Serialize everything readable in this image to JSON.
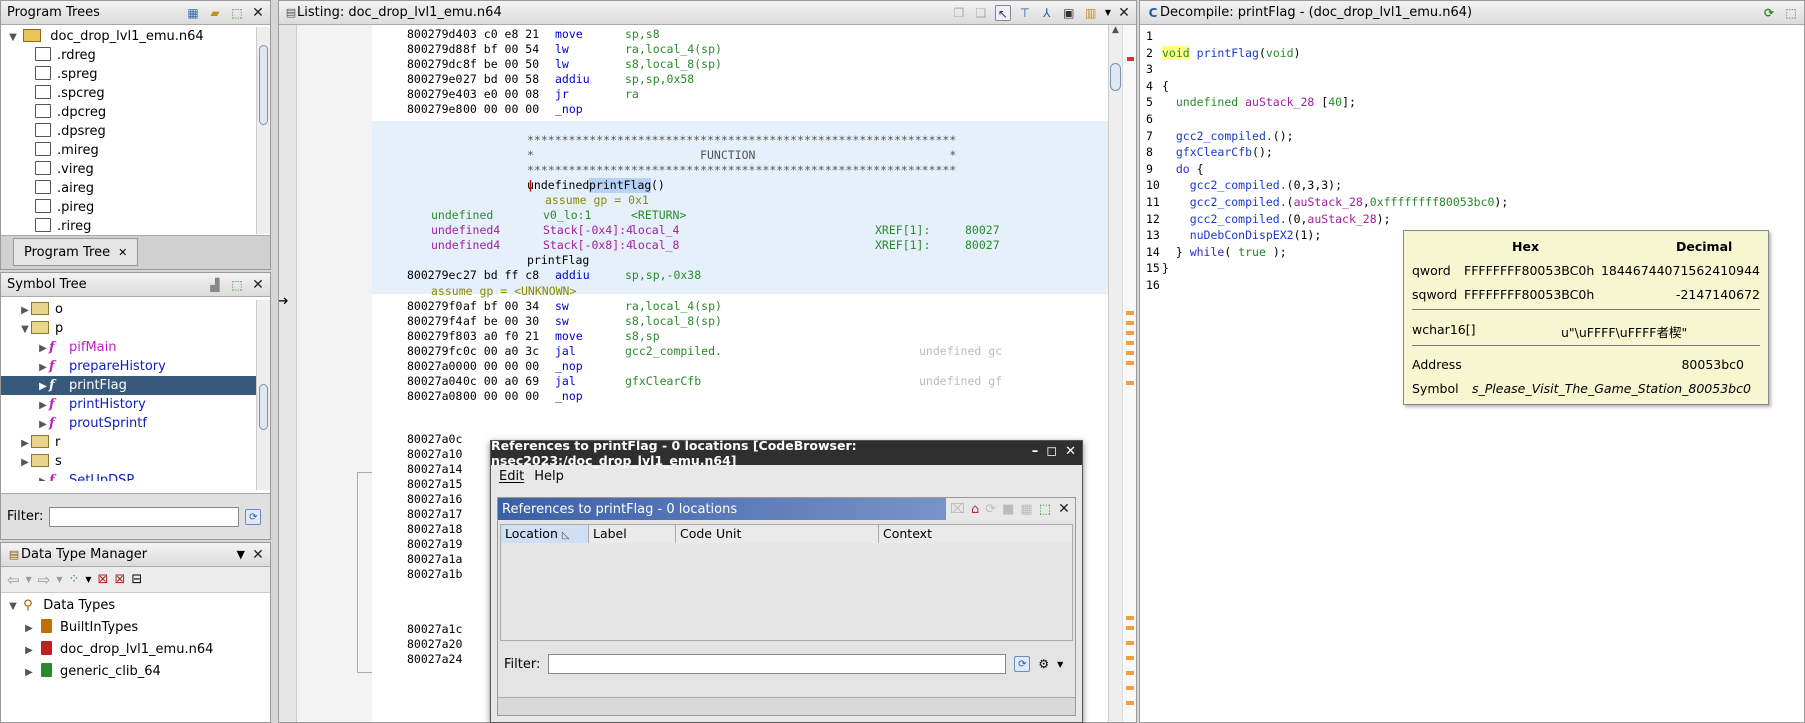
{
  "program_trees": {
    "title": "Program Trees",
    "root": "doc_drop_lvl1_emu.n64",
    "items": [
      ".rdreg",
      ".spreg",
      ".spcreg",
      ".dpcreg",
      ".dpsreg",
      ".mireg",
      ".vireg",
      ".aireg",
      ".pireg",
      ".rireg"
    ],
    "tab_label": "Program Tree"
  },
  "symbol_tree": {
    "title": "Symbol Tree",
    "folders_top": [
      "o",
      "p"
    ],
    "functions": [
      {
        "label": "pifMain",
        "color": "#c020c0"
      },
      {
        "label": "prepareHistory",
        "color": "#1020c0"
      },
      {
        "label": "printFlag",
        "color": "#ffffff",
        "selected": true
      },
      {
        "label": "printHistory",
        "color": "#1020c0"
      },
      {
        "label": "proutSprintf",
        "color": "#1020c0"
      }
    ],
    "folders_bottom": [
      "r",
      "s"
    ],
    "partial_last": "SetUpDSP",
    "filter_label": "Filter:"
  },
  "data_type_manager": {
    "title": "Data Type Manager",
    "root": "Data Types",
    "items": [
      "BuiltInTypes",
      "doc_drop_lvl1_emu.n64",
      "generic_clib_64"
    ]
  },
  "listing": {
    "title": "Listing:  doc_drop_lvl1_emu.n64",
    "top_lines": [
      {
        "addr": "800279d4",
        "bytes": "03 c0 e8 21",
        "mn": "move",
        "ops": "sp,s8"
      },
      {
        "addr": "800279d8",
        "bytes": "8f bf 00 54",
        "mn": "lw",
        "ops": "ra,local_4(sp)"
      },
      {
        "addr": "800279dc",
        "bytes": "8f be 00 50",
        "mn": "lw",
        "ops": "s8,local_8(sp)"
      },
      {
        "addr": "800279e0",
        "bytes": "27 bd 00 58",
        "mn": "addiu",
        "ops": "sp,sp,0x58"
      },
      {
        "addr": "800279e4",
        "bytes": "03 e0 00 08",
        "mn": "jr",
        "ops": "ra"
      },
      {
        "addr": "800279e8",
        "bytes": "00 00 00 00",
        "mn": "_nop",
        "ops": ""
      }
    ],
    "stars": "**************************************************************",
    "function_banner": "*                        FUNCTION                            *",
    "signature_pre": "undefined ",
    "signature_name": "printFlag",
    "signature_post": "()",
    "assume1": "assume gp = 0x1",
    "vars": [
      {
        "type": "undefined",
        "loc": "v0_lo:1",
        "name": "<RETURN>",
        "xref": ""
      },
      {
        "type": "undefined4",
        "loc": "Stack[-0x4]:4",
        "name": "local_4",
        "xref": "XREF[1]:     80027"
      },
      {
        "type": "undefined4",
        "loc": "Stack[-0x8]:4",
        "name": "local_8",
        "xref": "XREF[1]:     80027"
      }
    ],
    "label": "printFlag",
    "mid_lines": [
      {
        "addr": "800279ec",
        "bytes": "27 bd ff c8",
        "mn": "addiu",
        "ops": "sp,sp,-0x38"
      }
    ],
    "assume2": "assume gp = <UNKNOWN>",
    "lower_lines": [
      {
        "addr": "800279f0",
        "bytes": "af bf 00 34",
        "mn": "sw",
        "ops": "ra,local_4(sp)",
        "extra": ""
      },
      {
        "addr": "800279f4",
        "bytes": "af be 00 30",
        "mn": "sw",
        "ops": "s8,local_8(sp)",
        "extra": ""
      },
      {
        "addr": "800279f8",
        "bytes": "03 a0 f0 21",
        "mn": "move",
        "ops": "s8,sp",
        "extra": ""
      },
      {
        "addr": "800279fc",
        "bytes": "0c 00 a0 3c",
        "mn": "jal",
        "ops": "gcc2_compiled.",
        "extra": "undefined gc"
      },
      {
        "addr": "80027a00",
        "bytes": "00 00 00 00",
        "mn": "_nop",
        "ops": "",
        "extra": ""
      },
      {
        "addr": "80027a04",
        "bytes": "0c 00 a0 69",
        "mn": "jal",
        "ops": "gfxClearCfb",
        "extra": "undefined gf"
      },
      {
        "addr": "80027a08",
        "bytes": "00 00 00 00",
        "mn": "_nop",
        "ops": "",
        "extra": ""
      }
    ],
    "bottom_addrs": [
      "80027a0c",
      "80027a10",
      "80027a14",
      "80027a15",
      "80027a16",
      "80027a17",
      "80027a18",
      "80027a19",
      "80027a1a",
      "80027a1b"
    ],
    "tail_addrs": [
      "80027a1c",
      "80027a20",
      "80027a24"
    ]
  },
  "decompile": {
    "title": "Decompile: printFlag -  (doc_drop_lvl1_emu.n64)",
    "lines": [
      {
        "n": "1",
        "parts": []
      },
      {
        "n": "2",
        "parts": [
          [
            "void",
            "c-type hl"
          ],
          [
            " ",
            ""
          ],
          [
            "printFlag",
            "c-fn"
          ],
          [
            "(",
            ""
          ],
          [
            "void",
            "c-type"
          ],
          [
            ")",
            ""
          ]
        ]
      },
      {
        "n": "3",
        "parts": []
      },
      {
        "n": "4",
        "parts": [
          [
            "{",
            ""
          ]
        ]
      },
      {
        "n": "5",
        "parts": [
          [
            "  ",
            ""
          ],
          [
            "undefined",
            "c-type"
          ],
          [
            " ",
            ""
          ],
          [
            "auStack_28",
            "c-var"
          ],
          [
            " [",
            ""
          ],
          [
            "40",
            "hex2"
          ],
          [
            "];",
            ""
          ]
        ]
      },
      {
        "n": "6",
        "parts": []
      },
      {
        "n": "7",
        "parts": [
          [
            "  ",
            ""
          ],
          [
            "gcc2_compiled.",
            "c-fn"
          ],
          [
            "();",
            ""
          ]
        ]
      },
      {
        "n": "8",
        "parts": [
          [
            "  ",
            ""
          ],
          [
            "gfxClearCfb",
            "c-fn"
          ],
          [
            "();",
            ""
          ]
        ]
      },
      {
        "n": "9",
        "parts": [
          [
            "  ",
            ""
          ],
          [
            "do",
            "c-kw2"
          ],
          [
            " {",
            ""
          ]
        ]
      },
      {
        "n": "10",
        "parts": [
          [
            "    ",
            ""
          ],
          [
            "gcc2_compiled.",
            "c-fn"
          ],
          [
            "(0,3,3);",
            ""
          ]
        ]
      },
      {
        "n": "11",
        "parts": [
          [
            "    ",
            ""
          ],
          [
            "gcc2_compiled.",
            "c-fn"
          ],
          [
            "(",
            ""
          ],
          [
            "auStack_28",
            "c-var"
          ],
          [
            ",",
            ""
          ],
          [
            "0xffffffff80053bc0",
            "hex2"
          ],
          [
            ");",
            ""
          ]
        ]
      },
      {
        "n": "12",
        "parts": [
          [
            "    ",
            ""
          ],
          [
            "gcc2_compiled.",
            "c-fn"
          ],
          [
            "(0,",
            ""
          ],
          [
            "auStack_28",
            "c-var"
          ],
          [
            ");",
            ""
          ]
        ]
      },
      {
        "n": "13",
        "parts": [
          [
            "    ",
            ""
          ],
          [
            "nuDebConDispEX2",
            "c-fn"
          ],
          [
            "(1);",
            ""
          ]
        ]
      },
      {
        "n": "14",
        "parts": [
          [
            "  } ",
            ""
          ],
          [
            "while",
            "c-kw2"
          ],
          [
            "( ",
            ""
          ],
          [
            "true",
            "c-true"
          ],
          [
            " );",
            ""
          ]
        ]
      },
      {
        "n": "15",
        "parts": [
          [
            "}",
            ""
          ]
        ]
      },
      {
        "n": "16",
        "parts": []
      }
    ]
  },
  "hover_popup": {
    "col_hex": "Hex",
    "col_dec": "Decimal",
    "rows": [
      {
        "k": "qword",
        "hex": "FFFFFFFF80053BC0h",
        "dec": "18446744071562410944"
      },
      {
        "k": "sqword",
        "hex": "FFFFFFFF80053BC0h",
        "dec": "-2147140672"
      }
    ],
    "wchar_k": "wchar16[]",
    "wchar_v": "u\"\\uFFFF\\uFFFF者楔\"",
    "addr_k": "Address",
    "addr_v": "80053bc0",
    "sym_k": "Symbol",
    "sym_v": "s_Please_Visit_The_Game_Station_80053bc0"
  },
  "refs_dialog": {
    "title": "References to printFlag - 0 locations [CodeBrowser: nsec2023:/doc_drop_lvl1_emu.n64]",
    "menu_edit": "Edit",
    "menu_help": "Help",
    "inner_title": "References to printFlag - 0 locations",
    "columns": [
      "Location",
      "Label",
      "Code Unit",
      "Context"
    ],
    "filter_label": "Filter:"
  }
}
